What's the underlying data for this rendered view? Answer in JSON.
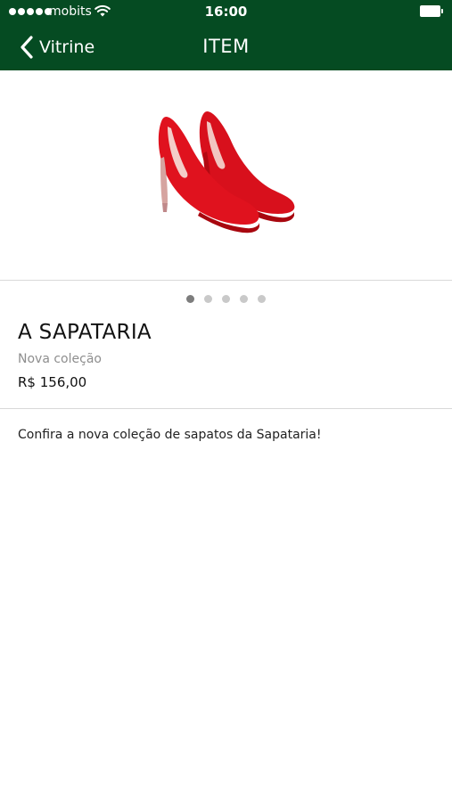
{
  "status_bar": {
    "carrier": "mobits",
    "time": "16:00",
    "signal_icon": "signal-dots-icon",
    "wifi_icon": "wifi-icon",
    "battery_icon": "battery-icon"
  },
  "nav": {
    "back_label": "Vitrine",
    "back_icon": "chevron-left-icon",
    "title": "ITEM"
  },
  "product": {
    "image_icon": "red-high-heel-shoes-image",
    "carousel_pages": 5,
    "carousel_active_page": 1,
    "store_name": "A SAPATARIA",
    "subtitle": "Nova coleção",
    "price": "R$ 156,00",
    "description": "Confira a nova coleção de sapatos da Sapataria!"
  },
  "colors": {
    "header_bg": "#054b22",
    "header_text": "#ffffff",
    "shoe_red": "#d8101c",
    "dot_active": "#7d7d7d",
    "dot_inactive": "#c9c9c9"
  }
}
